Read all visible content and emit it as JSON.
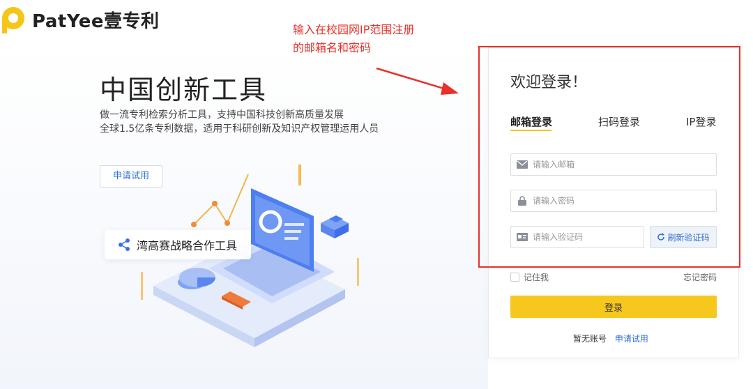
{
  "brand": {
    "logo_text": "PatYee壹专利"
  },
  "annotation": {
    "text_line1": "输入在校园网IP范围注册",
    "text_line2": "的邮箱名和密码",
    "color": "#e8312a"
  },
  "hero": {
    "title": "中国创新工具",
    "desc_line1": "做一流专利检索分析工具，支持中国科技创新高质量发展",
    "desc_line2": "全球1.5亿条专利数据，适用于科研创新及知识产权管理运用人员",
    "trial_button": "申请试用",
    "badge_text": "湾高赛战略合作工具"
  },
  "login": {
    "welcome": "欢迎登录！",
    "tabs": [
      {
        "label": "邮箱登录",
        "active": true
      },
      {
        "label": "扫码登录",
        "active": false
      },
      {
        "label": "IP登录",
        "active": false
      }
    ],
    "email_placeholder": "请输入邮箱",
    "password_placeholder": "请输入密码",
    "captcha_placeholder": "请输入验证码",
    "refresh_captcha": "刷新验证码",
    "remember_me": "记住我",
    "forgot_password": "忘记密码",
    "login_button": "登录",
    "no_account": "暂无账号",
    "apply_trial": "申请试用"
  },
  "colors": {
    "accent_yellow": "#f6c81d",
    "link_blue": "#2f6fd1",
    "highlight_red": "#e8312a"
  }
}
